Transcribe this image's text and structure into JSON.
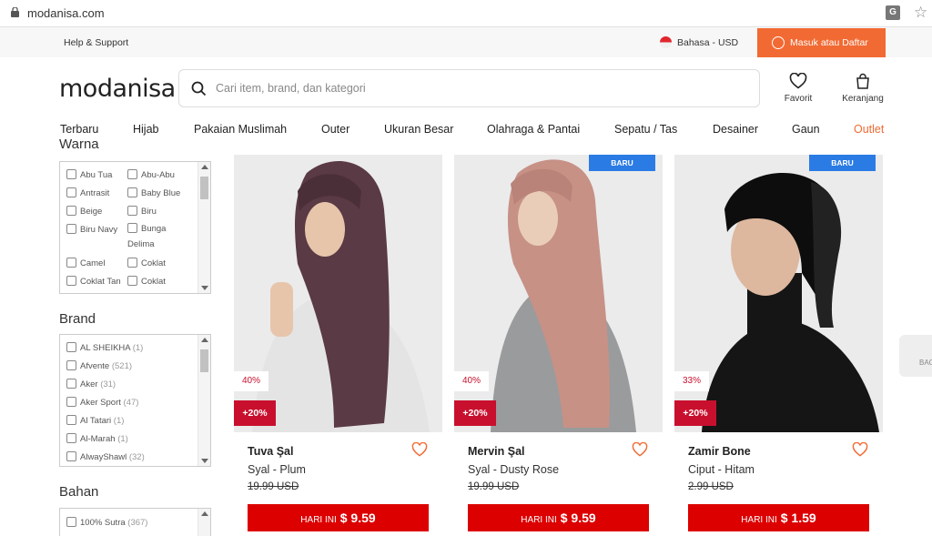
{
  "browser": {
    "url": "modanisa.com"
  },
  "utility": {
    "help": "Help & Support",
    "lang": "Bahasa - USD",
    "login": "Masuk atau Daftar"
  },
  "header": {
    "logo": "modanisa",
    "search_placeholder": "Cari item, brand, dan kategori",
    "favorite": "Favorit",
    "cart": "Keranjang"
  },
  "nav": [
    "Terbaru",
    "Hijab",
    "Pakaian Muslimah",
    "Outer",
    "Ukuran Besar",
    "Olahraga & Pantai",
    "Sepatu / Tas",
    "Desainer",
    "Gaun",
    "Outlet"
  ],
  "filters": {
    "color": {
      "title": "Warna",
      "options": [
        "Abu Tua",
        "Abu-Abu",
        "Antrasit",
        "Baby Blue",
        "Beige",
        "Biru",
        "Biru Navy",
        "Bunga Delima",
        "Camel",
        "Coklat",
        "Coklat Tan",
        "Coklat"
      ]
    },
    "brand": {
      "title": "Brand",
      "options": [
        {
          "name": "AL SHEIKHA",
          "count": "(1)"
        },
        {
          "name": "Afvente",
          "count": "(521)"
        },
        {
          "name": "Aker",
          "count": "(31)"
        },
        {
          "name": "Aker Sport",
          "count": "(47)"
        },
        {
          "name": "Al Tatari",
          "count": "(1)"
        },
        {
          "name": "Al-Marah",
          "count": "(1)"
        },
        {
          "name": "AlwayShawl",
          "count": "(32)"
        }
      ]
    },
    "material": {
      "title": "Bahan",
      "options": [
        {
          "name": "100% Sutra",
          "count": "(367)"
        }
      ]
    }
  },
  "products": [
    {
      "badge": "",
      "discount": "40%",
      "extra": "+20%",
      "brand": "Tuva Şal",
      "name": "Syal - Plum",
      "old_price": "19.99 USD",
      "price_label": "HARI INI",
      "price": "$ 9.59",
      "color": "#5a3a44"
    },
    {
      "badge": "BARU",
      "discount": "40%",
      "extra": "+20%",
      "brand": "Mervin Şal",
      "name": "Syal - Dusty Rose",
      "old_price": "19.99 USD",
      "price_label": "HARI INI",
      "price": "$ 9.59",
      "color": "#c79186"
    },
    {
      "badge": "BARU",
      "discount": "33%",
      "extra": "+20%",
      "brand": "Zamir Bone",
      "name": "Ciput - Hitam",
      "old_price": "2.99 USD",
      "price_label": "HARI INI",
      "price": "$ 1.59",
      "color": "#111111"
    }
  ],
  "side_tab": "BAC"
}
